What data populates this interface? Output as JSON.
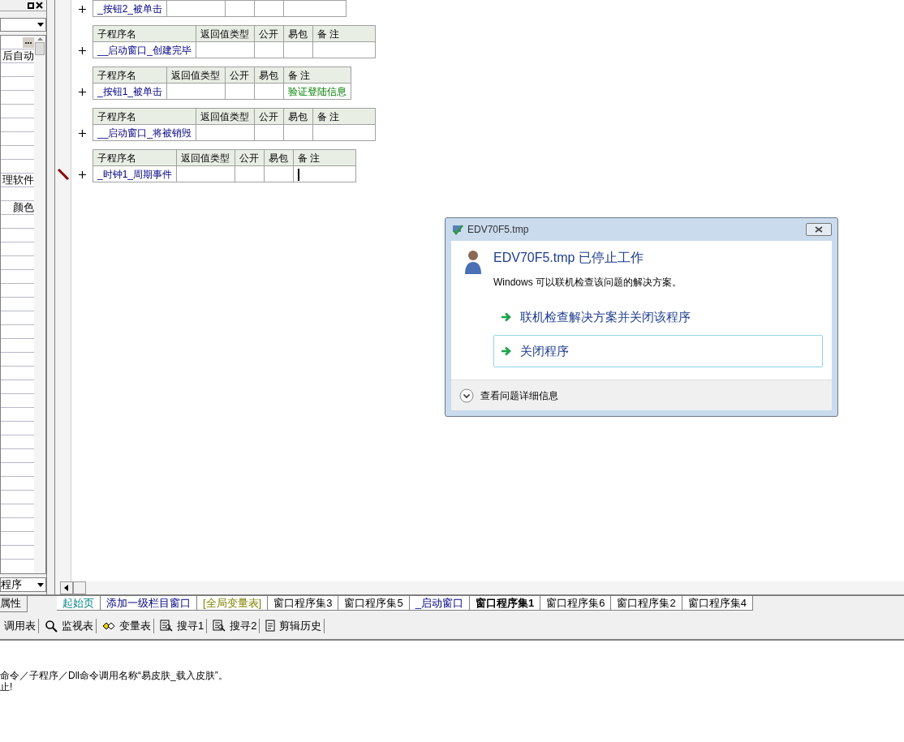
{
  "property_panel": {
    "values": [
      "后自动",
      "理软件",
      "颜色"
    ],
    "dropdown": "程序",
    "tab": "属性"
  },
  "subprograms": {
    "rows": [
      {
        "name": "_按钮2_被单击",
        "editing": false
      },
      {
        "columns": [
          "子程序名",
          "返回值类型",
          "公开",
          "易包",
          "备 注"
        ],
        "name": "__启动窗口_创建完毕",
        "editing": false
      },
      {
        "columns": [
          "子程序名",
          "返回值类型",
          "公开",
          "易包",
          "备 注"
        ],
        "name": "_按钮1_被单击",
        "remark": "验证登陆信息",
        "editing": false
      },
      {
        "columns": [
          "子程序名",
          "返回值类型",
          "公开",
          "易包",
          "备 注"
        ],
        "name": "__启动窗口_将被销毁",
        "editing": false
      },
      {
        "columns": [
          "子程序名",
          "返回值类型",
          "公开",
          "易包",
          "备 注"
        ],
        "name": "_时钟1_周期事件",
        "editing": true
      }
    ]
  },
  "tabs": [
    {
      "label": "起始页",
      "selected": false,
      "kind": "start"
    },
    {
      "label": "添加一级栏目窗口",
      "selected": false,
      "kind": "window"
    },
    {
      "label": "[全局变量表]",
      "selected": false,
      "kind": "globals"
    },
    {
      "label": "窗口程序集3",
      "selected": false,
      "kind": "program"
    },
    {
      "label": "窗口程序集5",
      "selected": false,
      "kind": "program"
    },
    {
      "label": "_启动窗口",
      "selected": false,
      "kind": "window"
    },
    {
      "label": "窗口程序集1",
      "selected": true,
      "kind": "program"
    },
    {
      "label": "窗口程序集6",
      "selected": false,
      "kind": "program"
    },
    {
      "label": "窗口程序集2",
      "selected": false,
      "kind": "program"
    },
    {
      "label": "窗口程序集4",
      "selected": false,
      "kind": "program"
    }
  ],
  "toolbar": [
    {
      "label": "调用表",
      "kind": "none"
    },
    {
      "label": "监视表",
      "kind": "search"
    },
    {
      "label": "变量表",
      "kind": "variables"
    },
    {
      "label": "搜寻1",
      "kind": "find"
    },
    {
      "label": "搜寻2",
      "kind": "find"
    },
    {
      "label": "剪辑历史",
      "kind": "clipboard"
    }
  ],
  "output": [
    "命令／子程序／Dll命令调用名称“易皮肤_载入皮肤”。",
    "止!"
  ],
  "dialog": {
    "title": "EDV70F5.tmp",
    "heading": "EDV70F5.tmp 已停止工作",
    "message": "Windows 可以联机检查该问题的解决方案。",
    "options": [
      {
        "label": "联机检查解决方案并关闭该程序",
        "selected": false
      },
      {
        "label": "关闭程序",
        "selected": true
      }
    ],
    "details": "查看问题详细信息"
  }
}
